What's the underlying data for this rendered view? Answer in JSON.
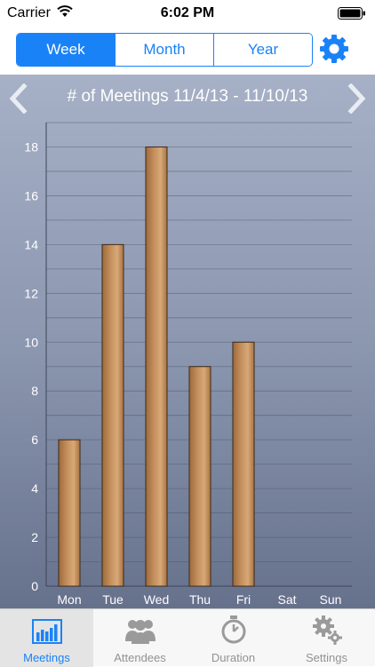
{
  "status_bar": {
    "carrier": "Carrier",
    "time": "6:02 PM"
  },
  "segments": [
    {
      "label": "Week",
      "active": true
    },
    {
      "label": "Month",
      "active": false
    },
    {
      "label": "Year",
      "active": false
    }
  ],
  "chart_title": "# of Meetings 11/4/13 - 11/10/13",
  "chart_data": {
    "type": "bar",
    "title": "# of Meetings 11/4/13 - 11/10/13",
    "categories": [
      "Mon",
      "Tue",
      "Wed",
      "Thu",
      "Fri",
      "Sat",
      "Sun"
    ],
    "values": [
      6,
      14,
      18,
      9,
      10,
      0,
      0
    ],
    "ylim": [
      0,
      19
    ],
    "y_ticks": [
      0,
      2,
      4,
      6,
      8,
      10,
      12,
      14,
      16,
      18
    ],
    "grid": true,
    "bar_color": "#c18c5a"
  },
  "tabs": [
    {
      "label": "Meetings",
      "icon": "bar-chart-icon",
      "active": true
    },
    {
      "label": "Attendees",
      "icon": "people-icon",
      "active": false
    },
    {
      "label": "Duration",
      "icon": "stopwatch-icon",
      "active": false
    },
    {
      "label": "Settings",
      "icon": "gears-icon",
      "active": false
    }
  ],
  "colors": {
    "accent": "#1a82f7",
    "chart_bg_top": "#a6b0c6",
    "chart_bg_bottom": "#66718c"
  }
}
